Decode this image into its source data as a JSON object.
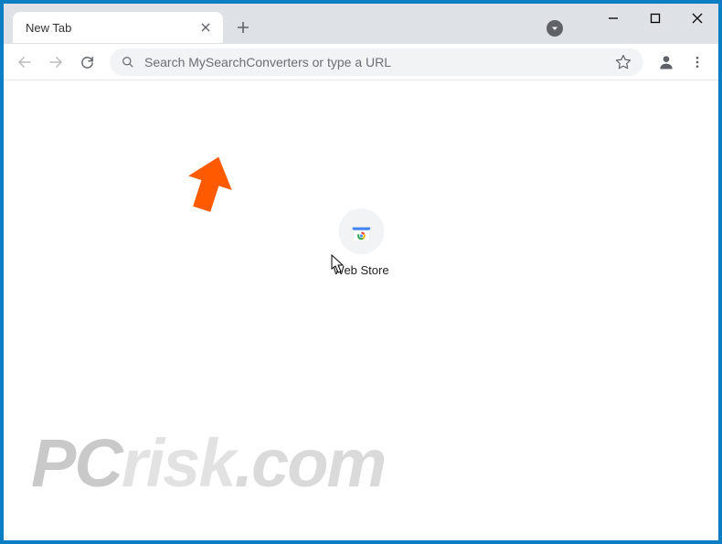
{
  "window": {
    "minimize": "minimize",
    "maximize": "maximize",
    "close": "close"
  },
  "tab": {
    "title": "New Tab"
  },
  "omnibox": {
    "placeholder": "Search MySearchConverters or type a URL",
    "value": ""
  },
  "shortcut": {
    "label": "Web Store"
  },
  "watermark": {
    "pc": "PC",
    "risk": "risk",
    "dot": ".com"
  },
  "colors": {
    "frame": "#0b7ec4",
    "tabstrip": "#dee1e6",
    "omnibox": "#f1f3f4",
    "pointer": "#ff5a00"
  }
}
